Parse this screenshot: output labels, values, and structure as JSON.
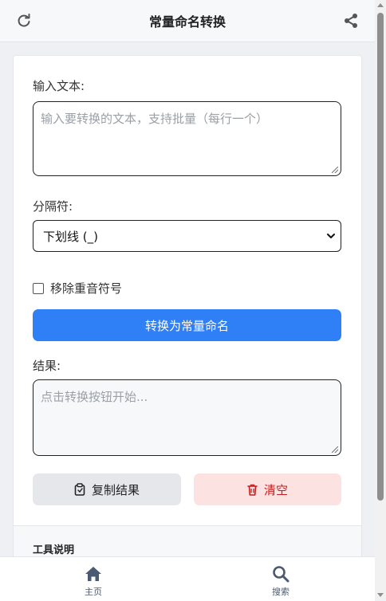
{
  "header": {
    "title": "常量命名转换",
    "refresh_icon": "refresh-icon",
    "share_icon": "share-icon"
  },
  "form": {
    "input_label": "输入文本:",
    "input_placeholder": "输入要转换的文本，支持批量（每行一个）",
    "separator_label": "分隔符:",
    "separator_value": "下划线 (_)",
    "remove_accents_label": "移除重音符号",
    "remove_accents_checked": false,
    "convert_button": "转换为常量命名",
    "result_label": "结果:",
    "result_placeholder": "点击转换按钮开始...",
    "copy_button": "复制结果",
    "clear_button": "清空"
  },
  "info": {
    "title": "工具说明"
  },
  "bottom_nav": {
    "items": [
      {
        "label": "主页",
        "icon": "home-icon"
      },
      {
        "label": "搜索",
        "icon": "search-icon"
      }
    ]
  },
  "colors": {
    "primary": "#2f7ff7",
    "danger_bg": "#fde2e2",
    "danger_text": "#c01e1e",
    "nav_icon": "#4b5a73"
  }
}
